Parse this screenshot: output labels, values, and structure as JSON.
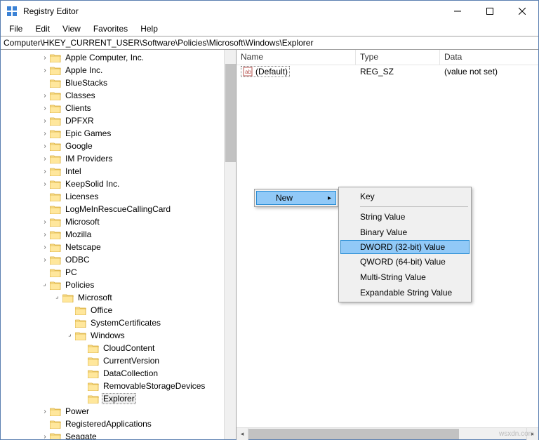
{
  "window": {
    "title": "Registry Editor"
  },
  "menubar": [
    "File",
    "Edit",
    "View",
    "Favorites",
    "Help"
  ],
  "addressbar": "Computer\\HKEY_CURRENT_USER\\Software\\Policies\\Microsoft\\Windows\\Explorer",
  "tree": [
    {
      "indent": 3,
      "toggle": ">",
      "label": "Apple Computer, Inc."
    },
    {
      "indent": 3,
      "toggle": ">",
      "label": "Apple Inc."
    },
    {
      "indent": 3,
      "toggle": "",
      "label": "BlueStacks"
    },
    {
      "indent": 3,
      "toggle": ">",
      "label": "Classes"
    },
    {
      "indent": 3,
      "toggle": ">",
      "label": "Clients"
    },
    {
      "indent": 3,
      "toggle": ">",
      "label": "DPFXR"
    },
    {
      "indent": 3,
      "toggle": ">",
      "label": "Epic Games"
    },
    {
      "indent": 3,
      "toggle": ">",
      "label": "Google"
    },
    {
      "indent": 3,
      "toggle": ">",
      "label": "IM Providers"
    },
    {
      "indent": 3,
      "toggle": ">",
      "label": "Intel"
    },
    {
      "indent": 3,
      "toggle": ">",
      "label": "KeepSolid Inc."
    },
    {
      "indent": 3,
      "toggle": "",
      "label": "Licenses"
    },
    {
      "indent": 3,
      "toggle": "",
      "label": "LogMeInRescueCallingCard"
    },
    {
      "indent": 3,
      "toggle": ">",
      "label": "Microsoft"
    },
    {
      "indent": 3,
      "toggle": ">",
      "label": "Mozilla"
    },
    {
      "indent": 3,
      "toggle": ">",
      "label": "Netscape"
    },
    {
      "indent": 3,
      "toggle": ">",
      "label": "ODBC"
    },
    {
      "indent": 3,
      "toggle": "",
      "label": "PC"
    },
    {
      "indent": 3,
      "toggle": "v",
      "label": "Policies"
    },
    {
      "indent": 4,
      "toggle": "v",
      "label": "Microsoft"
    },
    {
      "indent": 5,
      "toggle": "",
      "label": "Office"
    },
    {
      "indent": 5,
      "toggle": "",
      "label": "SystemCertificates"
    },
    {
      "indent": 5,
      "toggle": "v",
      "label": "Windows"
    },
    {
      "indent": 6,
      "toggle": "",
      "label": "CloudContent"
    },
    {
      "indent": 6,
      "toggle": "",
      "label": "CurrentVersion"
    },
    {
      "indent": 6,
      "toggle": "",
      "label": "DataCollection"
    },
    {
      "indent": 6,
      "toggle": "",
      "label": "RemovableStorageDevices"
    },
    {
      "indent": 6,
      "toggle": "",
      "label": "Explorer",
      "selected": true
    },
    {
      "indent": 3,
      "toggle": ">",
      "label": "Power"
    },
    {
      "indent": 3,
      "toggle": "",
      "label": "RegisteredApplications"
    },
    {
      "indent": 3,
      "toggle": ">",
      "label": "Seagate"
    }
  ],
  "list": {
    "columns": {
      "name": "Name",
      "type": "Type",
      "data": "Data"
    },
    "col_widths": {
      "name": 170,
      "type": 120,
      "data": 140
    },
    "rows": [
      {
        "name": "(Default)",
        "type": "REG_SZ",
        "data": "(value not set)"
      }
    ]
  },
  "context": {
    "parent": {
      "label": "New"
    },
    "submenu": [
      {
        "label": "Key",
        "sep_after": true
      },
      {
        "label": "String Value"
      },
      {
        "label": "Binary Value"
      },
      {
        "label": "DWORD (32-bit) Value",
        "highlight": true
      },
      {
        "label": "QWORD (64-bit) Value"
      },
      {
        "label": "Multi-String Value"
      },
      {
        "label": "Expandable String Value"
      }
    ]
  },
  "watermark": "wsxdn.com"
}
